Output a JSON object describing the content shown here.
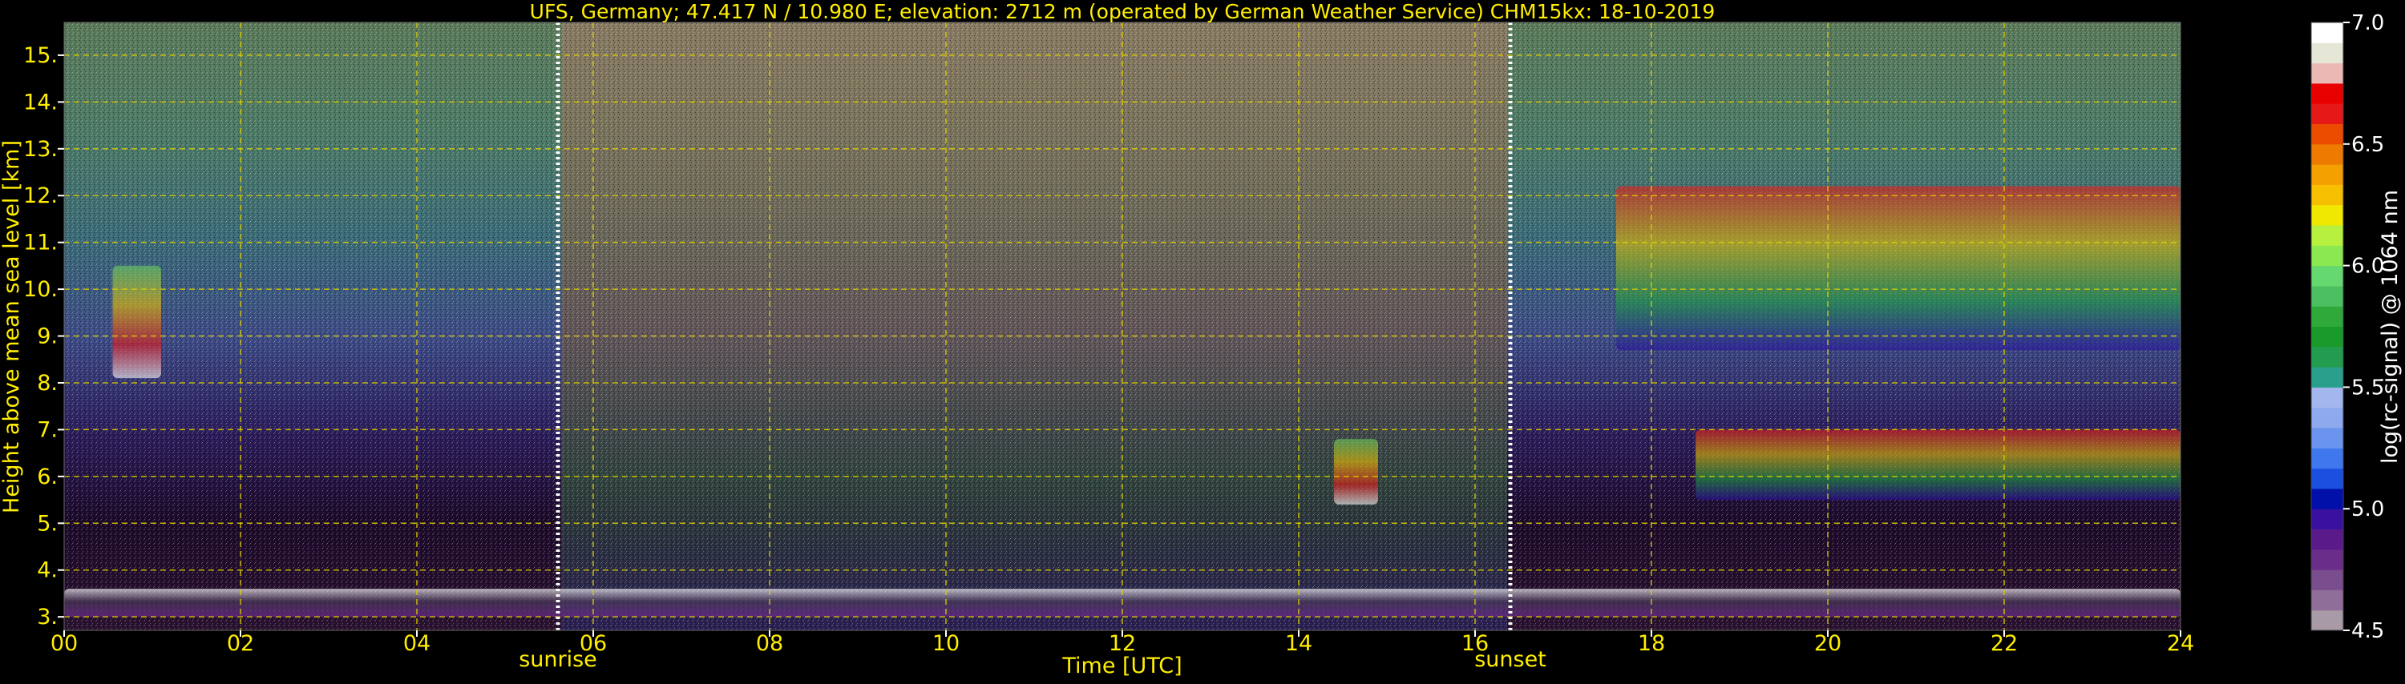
{
  "chart_data": {
    "type": "heatmap",
    "title": "UFS, Germany; 47.417 N / 10.980 E; elevation: 2712 m  (operated by German Weather Service)    CHM15kx: 18-10-2019",
    "xlabel": "Time [UTC]",
    "ylabel": "Height above mean sea level [km]",
    "xlim": [
      0,
      24
    ],
    "ylim": [
      2.712,
      15.7
    ],
    "x_ticks": [
      0,
      2,
      4,
      6,
      8,
      10,
      12,
      14,
      16,
      18,
      20,
      22,
      24
    ],
    "x_tick_labels": [
      "00",
      "02",
      "04",
      "06",
      "08",
      "10",
      "12",
      "14",
      "16",
      "18",
      "20",
      "22",
      "24"
    ],
    "y_ticks": [
      3,
      4,
      5,
      6,
      7,
      8,
      9,
      10,
      11,
      12,
      13,
      14,
      15
    ],
    "y_tick_labels": [
      "3.",
      "4.",
      "5.",
      "6.",
      "7.",
      "8.",
      "9.",
      "10.",
      "11.",
      "12.",
      "13.",
      "14.",
      "15."
    ],
    "grid": true,
    "colorbar": {
      "label": "log(rc-signal) @ 1064 nm",
      "range": [
        4.5,
        7.0
      ],
      "ticks": [
        4.5,
        5.0,
        5.5,
        6.0,
        6.5,
        7.0
      ],
      "tick_labels": [
        "4.5",
        "5.0",
        "5.5",
        "6.0",
        "6.5",
        "7.0"
      ],
      "colors": [
        "#a89aa6",
        "#8f6e99",
        "#7a4d8f",
        "#6a2d8a",
        "#5a1a8a",
        "#3a10a0",
        "#0010a8",
        "#1a4fe0",
        "#3f78ee",
        "#6a94ee",
        "#8fa9ee",
        "#a4b6ee",
        "#2aa08c",
        "#239c50",
        "#1a9a2a",
        "#2faa3a",
        "#4cc060",
        "#66d870",
        "#8ce850",
        "#b8f040",
        "#f0e800",
        "#f6c000",
        "#f4a000",
        "#ee7a00",
        "#ec4c00",
        "#e61818",
        "#e80000",
        "#ecb8b4",
        "#e6e6d6",
        "#ffffff"
      ]
    },
    "markers": [
      {
        "label": "sunrise",
        "x": 5.6
      },
      {
        "label": "sunset",
        "x": 16.4
      }
    ],
    "signal_features": [
      {
        "kind": "boundary layer top",
        "t_start": 0,
        "t_end": 24,
        "height_km": [
          3.0,
          3.6
        ]
      },
      {
        "kind": "cloud",
        "t_start": 0.55,
        "t_end": 1.1,
        "height_km": [
          8.1,
          10.5
        ]
      },
      {
        "kind": "cloud",
        "t_start": 14.4,
        "t_end": 14.9,
        "height_km": [
          5.4,
          6.8
        ]
      },
      {
        "kind": "cirrus",
        "t_start": 17.6,
        "t_end": 24,
        "height_km": [
          8.7,
          12.2
        ]
      },
      {
        "kind": "mid-level cloud layer",
        "t_start": 18.5,
        "t_end": 24,
        "height_km": [
          5.5,
          7.0
        ]
      }
    ]
  }
}
